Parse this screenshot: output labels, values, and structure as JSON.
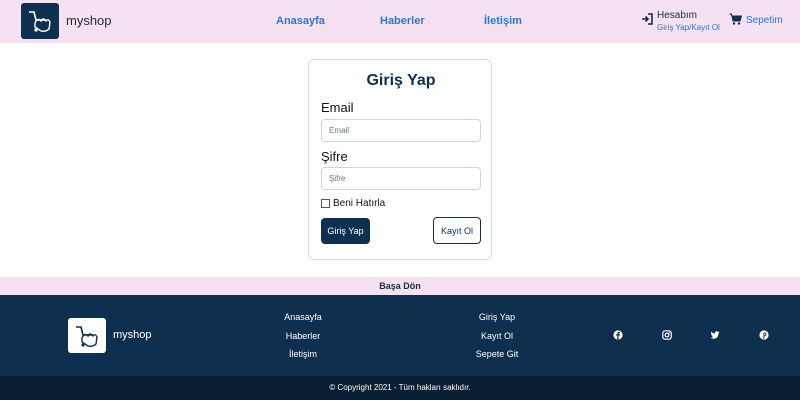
{
  "header": {
    "brand": "myshop",
    "nav": [
      "Anasayfa",
      "Haberler",
      "İletişim"
    ],
    "account": {
      "title": "Hesabım",
      "subtitle": "Giriş Yap/Kayıt Ol"
    },
    "cart": "Sepetim"
  },
  "login": {
    "title": "Giriş Yap",
    "email_label": "Email",
    "email_placeholder": "Email",
    "password_label": "Şifre",
    "password_placeholder": "Şifre",
    "remember_label": "Beni Hatırla",
    "submit_label": "Giriş Yap",
    "register_label": "Kayıt Ol"
  },
  "back_to_top": "Başa Dön",
  "footer": {
    "brand": "myshop",
    "col1": [
      "Anasayfa",
      "Haberler",
      "İletişim"
    ],
    "col2": [
      "Giriş Yap",
      "Kayıt Ol",
      "Sepete Git"
    ],
    "social": [
      "facebook-icon",
      "instagram-icon",
      "twitter-icon",
      "pinterest-icon"
    ],
    "copyright": "© Copyright 2021 - Tüm hakları saklıdır."
  },
  "colors": {
    "brand_navy": "#0f2f4f",
    "link_blue": "#2b78d6",
    "header_pink": "#f5e1ef"
  }
}
